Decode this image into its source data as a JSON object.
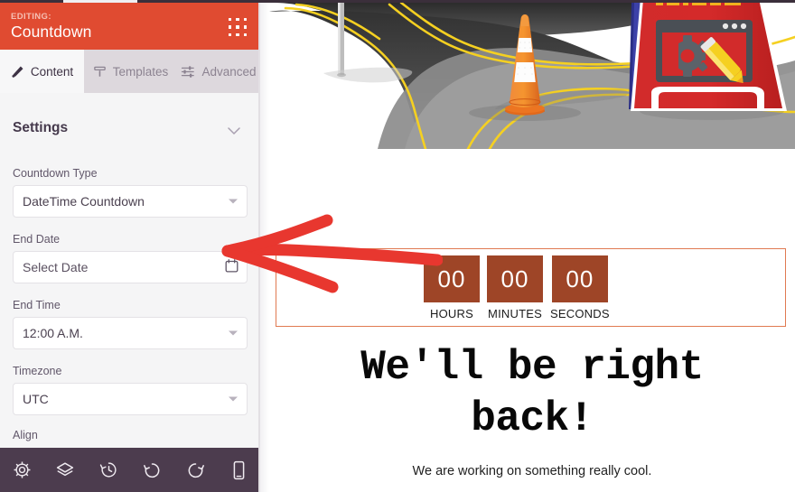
{
  "panel": {
    "header": {
      "eyebrow": "EDITING:",
      "title": "Countdown",
      "grid_icon": "grid-dots-icon"
    },
    "tabs": [
      {
        "label": "Content",
        "icon": "pencil-icon",
        "active": true
      },
      {
        "label": "Templates",
        "icon": "template-icon",
        "active": false
      },
      {
        "label": "Advanced",
        "icon": "sliders-icon",
        "active": false
      }
    ],
    "section": {
      "title": "Settings",
      "chevron_icon": "chevron-down-icon"
    },
    "fields": [
      {
        "label": "Countdown Type",
        "value": "DateTime Countdown",
        "control": "select",
        "icon": "caret-down-icon"
      },
      {
        "label": "End Date",
        "value": "Select Date",
        "placeholder": "Select Date",
        "control": "date",
        "icon": "calendar-icon"
      },
      {
        "label": "End Time",
        "value": "12:00 A.M.",
        "control": "select",
        "icon": "caret-down-icon"
      },
      {
        "label": "Timezone",
        "value": "UTC",
        "control": "select",
        "icon": "caret-down-icon"
      }
    ],
    "align_label": "Align",
    "bottom_toolbar": [
      {
        "name": "settings-icon"
      },
      {
        "name": "layers-icon"
      },
      {
        "name": "revision-history-icon"
      },
      {
        "name": "undo-icon"
      },
      {
        "name": "redo-icon"
      },
      {
        "name": "mobile-preview-icon"
      }
    ]
  },
  "preview": {
    "illustration": "road-construction-cone-sign-illustration",
    "countdown": {
      "units": [
        {
          "value": "00",
          "label": "HOURS"
        },
        {
          "value": "00",
          "label": "MINUTES"
        },
        {
          "value": "00",
          "label": "SECONDS"
        }
      ]
    },
    "headline": "We'll be right back!",
    "subline": "We are working on something really cool."
  },
  "annotation": {
    "arrow": "red-arrow-pointing-left",
    "color": "#e8372f"
  },
  "colors": {
    "header_red": "#e04b31",
    "countdown_brown": "#9e4527",
    "countdown_border": "#e07a52",
    "bottom_bar": "#4c3c4e",
    "panel_bg": "#f5f5f6",
    "tabbar_bg": "#ddd8dd"
  }
}
